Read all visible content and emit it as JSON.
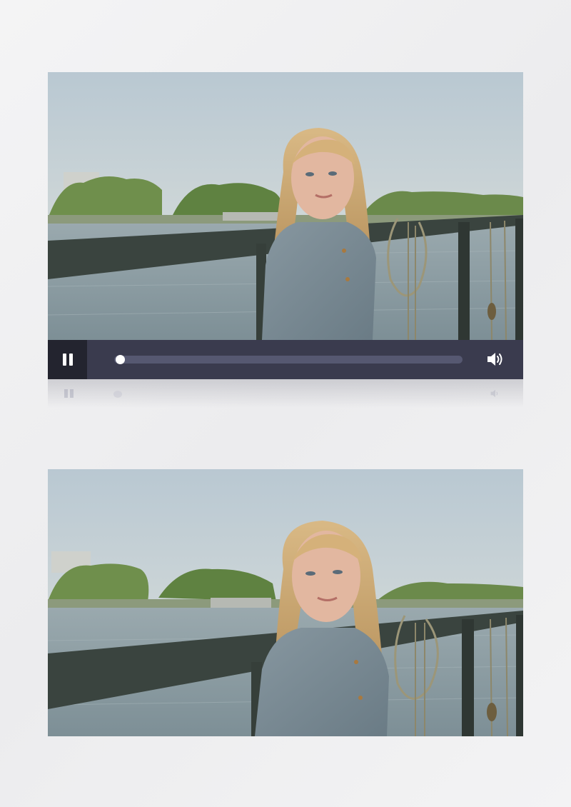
{
  "player": {
    "state": "playing",
    "play_pause_icon": "pause-icon",
    "volume_icon": "volume-icon",
    "progress": 0.0,
    "colors": {
      "control_bar": "#3a3b4e",
      "play_button_bg": "#23242f",
      "track": "#565871",
      "knob": "#ffffff"
    }
  },
  "frames": [
    {
      "subject": "girl-with-braids-on-pier",
      "has_controls": true
    },
    {
      "subject": "girl-with-braids-on-pier",
      "has_controls": false
    }
  ]
}
